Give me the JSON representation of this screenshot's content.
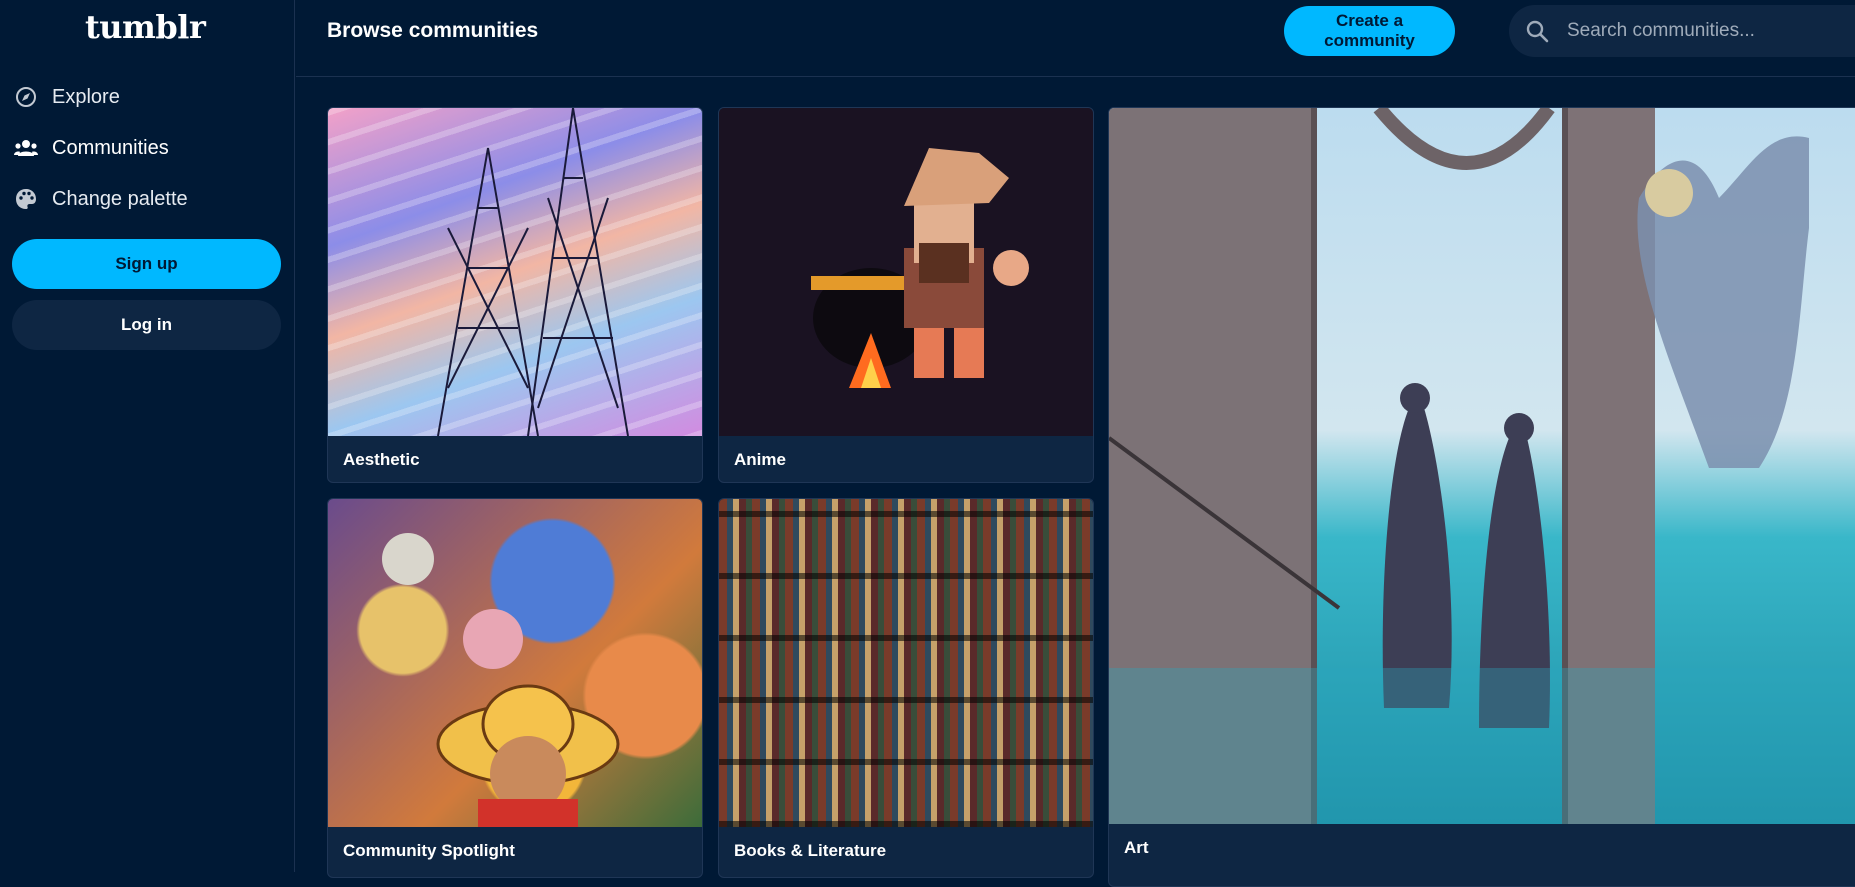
{
  "app": {
    "logo": "tumblr"
  },
  "sidebar": {
    "items": [
      {
        "label": "Explore",
        "icon": "compass-icon"
      },
      {
        "label": "Communities",
        "icon": "people-icon"
      },
      {
        "label": "Change palette",
        "icon": "palette-icon"
      }
    ],
    "signup_label": "Sign up",
    "login_label": "Log in"
  },
  "header": {
    "title": "Browse communities",
    "create_label": "Create a community",
    "search_placeholder": "Search communities..."
  },
  "communities": [
    {
      "name": "Aesthetic"
    },
    {
      "name": "Anime"
    },
    {
      "name": "Art"
    },
    {
      "name": "Community Spotlight"
    },
    {
      "name": "Books & Literature"
    }
  ],
  "colors": {
    "background": "#001935",
    "accent": "#00b8ff",
    "card": "#0e2643"
  }
}
